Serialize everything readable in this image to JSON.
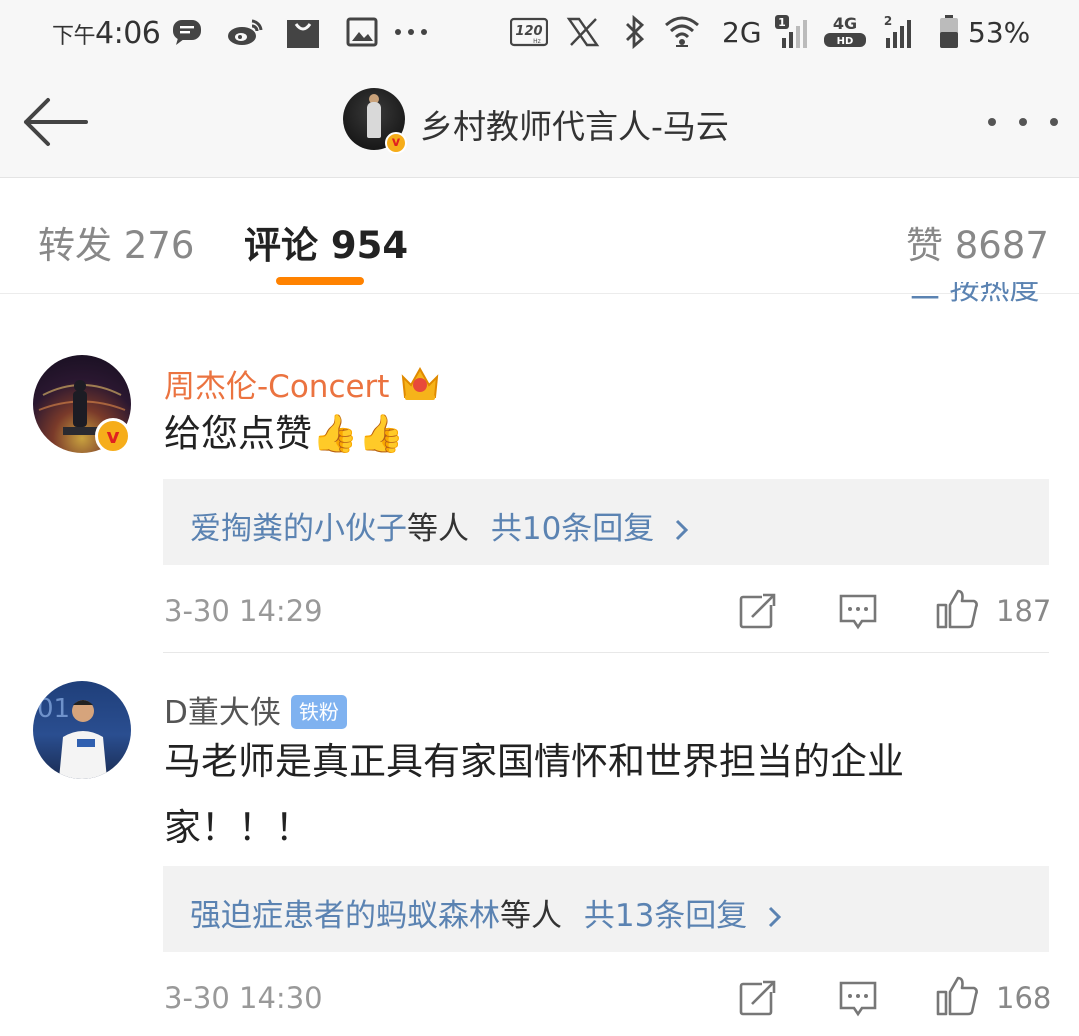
{
  "status_bar": {
    "time_prefix": "下午",
    "time": "4:06",
    "refresh_rate": "120",
    "network_1": "2G",
    "sim1_label": "1",
    "network_2": "4G",
    "network_2_sub": "HD",
    "sim2_label": "2",
    "battery": "53%",
    "icons": [
      "message-icon",
      "weibo-icon",
      "shopping-bag-icon",
      "gallery-icon",
      "more-dots-icon",
      "refresh-rate-icon",
      "x-icon",
      "bluetooth-icon",
      "wifi-icon",
      "signal-icon",
      "signal-icon",
      "battery-icon"
    ]
  },
  "header": {
    "title": "乡村教师代言人-马云",
    "verified_badge": "v"
  },
  "tabs": {
    "repost": "转发 276",
    "comments": "评论 954",
    "likes": "赞 8687"
  },
  "partial_sort_label": "二 按热度",
  "comments": [
    {
      "username": "周杰伦-Concert",
      "verified_badge": "v",
      "text": "给您点赞👍👍",
      "reply_names": "爱掏粪的小伙子",
      "reply_suffix": "等人",
      "reply_count": "共10条回复",
      "timestamp": "3-30 14:29",
      "likes": "187"
    },
    {
      "username": "D董大侠",
      "fan_badge": "铁粉",
      "text": "马老师是真正具有家国情怀和世界担当的企业家！！！",
      "reply_names": "强迫症患者的蚂蚁森林",
      "reply_suffix": "等人",
      "reply_count": "共13条回复",
      "timestamp": "3-30 14:30",
      "likes": "168"
    }
  ],
  "colors": {
    "accent": "#ff8200",
    "link": "#5b83b2",
    "vip_name": "#eb7340",
    "badge": "#7fb2f0"
  }
}
